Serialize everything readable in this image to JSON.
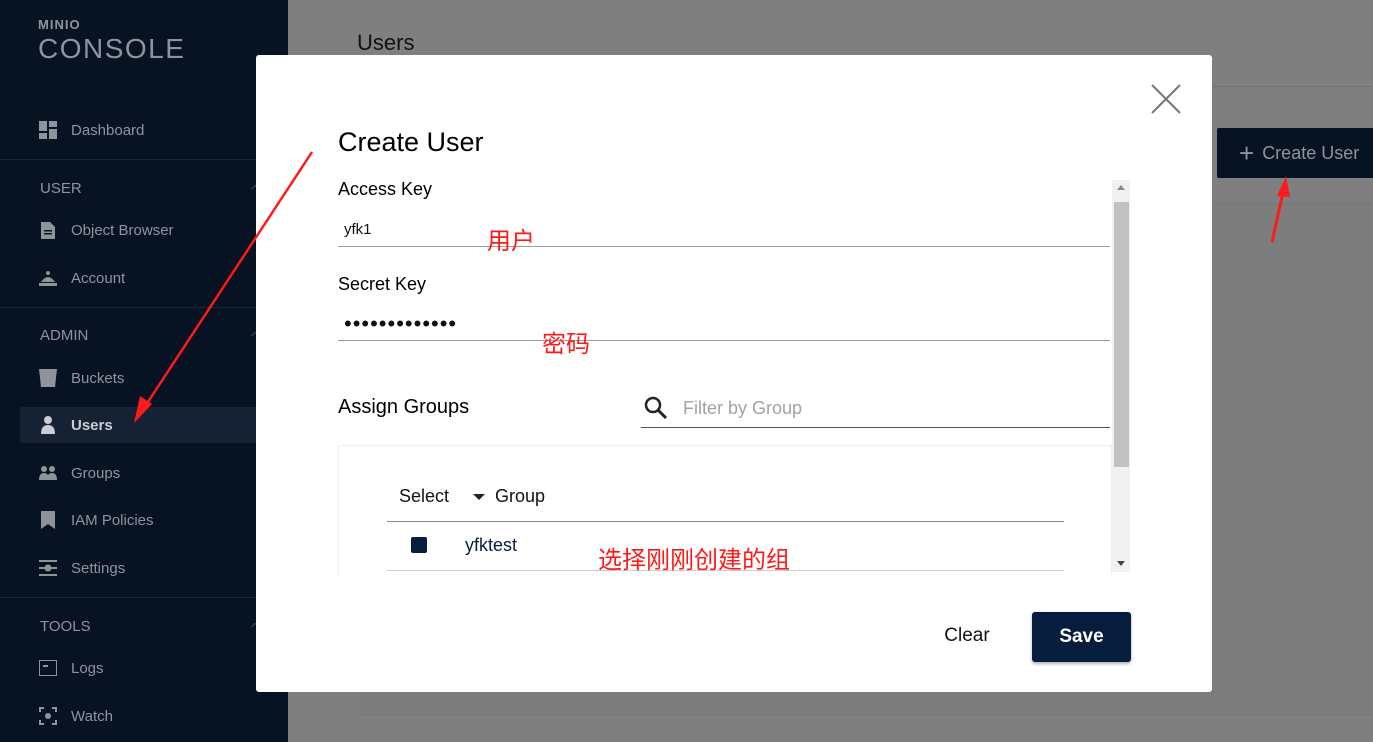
{
  "colors": {
    "sidebar_bg": "#071323",
    "primary": "#071d3e",
    "annotation": "#ff1a1a"
  },
  "sidebar": {
    "logo_small": "MINIO",
    "logo_big": "CONSOLE",
    "dashboard": {
      "label": "Dashboard",
      "icon": "dashboard-icon"
    },
    "user_section": "USER",
    "user_items": [
      {
        "label": "Object Browser",
        "icon": "document-icon"
      },
      {
        "label": "Account",
        "icon": "account-icon"
      }
    ],
    "admin_section": "ADMIN",
    "admin_items": [
      {
        "label": "Buckets",
        "icon": "bucket-icon"
      },
      {
        "label": "Users",
        "icon": "user-icon",
        "active": true
      },
      {
        "label": "Groups",
        "icon": "groups-icon"
      },
      {
        "label": "IAM Policies",
        "icon": "bookmark-icon"
      },
      {
        "label": "Settings",
        "icon": "settings-icon"
      }
    ],
    "tools_section": "TOOLS",
    "tools_items": [
      {
        "label": "Logs",
        "icon": "logs-icon"
      },
      {
        "label": "Watch",
        "icon": "watch-icon"
      }
    ]
  },
  "page": {
    "title": "Users",
    "create_button": "Create User"
  },
  "modal": {
    "title": "Create User",
    "access_key_label": "Access Key",
    "access_key_value": "yfk1",
    "secret_key_label": "Secret Key",
    "secret_key_value": "•••••••••••••",
    "assign_groups_label": "Assign Groups",
    "filter_placeholder": "Filter by Group",
    "table": {
      "select_header": "Select",
      "group_header": "Group",
      "rows": [
        {
          "name": "yfktest",
          "selected": true
        }
      ]
    },
    "clear_label": "Clear",
    "save_label": "Save"
  },
  "annotations": {
    "user": "用户",
    "password": "密码",
    "select_group": "选择刚刚创建的组"
  }
}
